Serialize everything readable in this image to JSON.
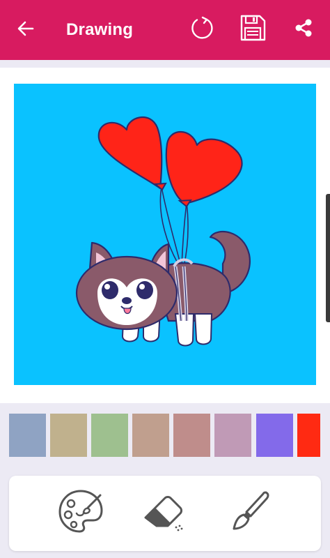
{
  "toolbar": {
    "title": "Drawing",
    "background": "#d81b60",
    "icons": [
      "back-arrow-icon",
      "refresh-icon",
      "save-icon",
      "share-icon"
    ]
  },
  "canvas": {
    "background": "#0ac2ff",
    "image": "husky-puppy-with-heart-balloons"
  },
  "palette": {
    "colors": [
      "#8fa3c3",
      "#c0b18d",
      "#9ec08f",
      "#c09f8e",
      "#bf8d8b",
      "#c09ab6",
      "#836aea",
      "#ff2a12"
    ]
  },
  "tools": {
    "items": [
      "palette-icon",
      "eraser-icon",
      "brush-icon"
    ]
  }
}
